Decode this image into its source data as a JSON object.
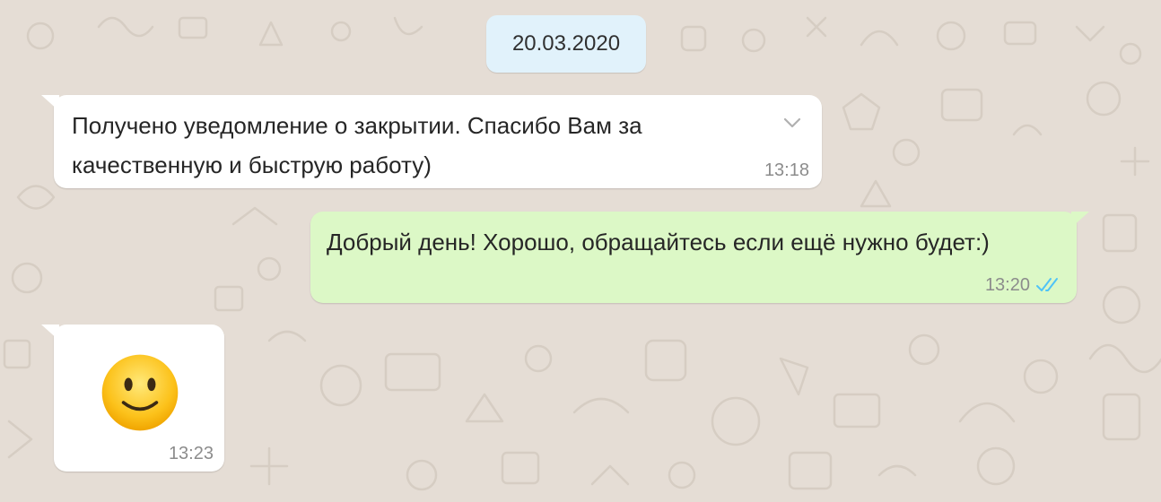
{
  "chat": {
    "date_chip": "20.03.2020",
    "messages": [
      {
        "direction": "incoming",
        "text": "Получено уведомление о закрытии. Спасибо Вам за\nкачественную и быструю работу)",
        "time": "13:18"
      },
      {
        "direction": "outgoing",
        "text": "Добрый день! Хорошо, обращайтесь если ещё нужно будет:)",
        "time": "13:20",
        "status": "read",
        "status_icon": "double-check-icon"
      },
      {
        "direction": "incoming",
        "emoji": "slightly-smiling-face",
        "time": "13:23"
      }
    ]
  },
  "colors": {
    "wallpaper": "#e5ddd5",
    "incoming_bubble": "#ffffff",
    "outgoing_bubble": "#dcf8c6",
    "date_chip": "#e1f2fb",
    "read_ticks": "#4fc3f7",
    "time_text": "#8c8c8c"
  }
}
